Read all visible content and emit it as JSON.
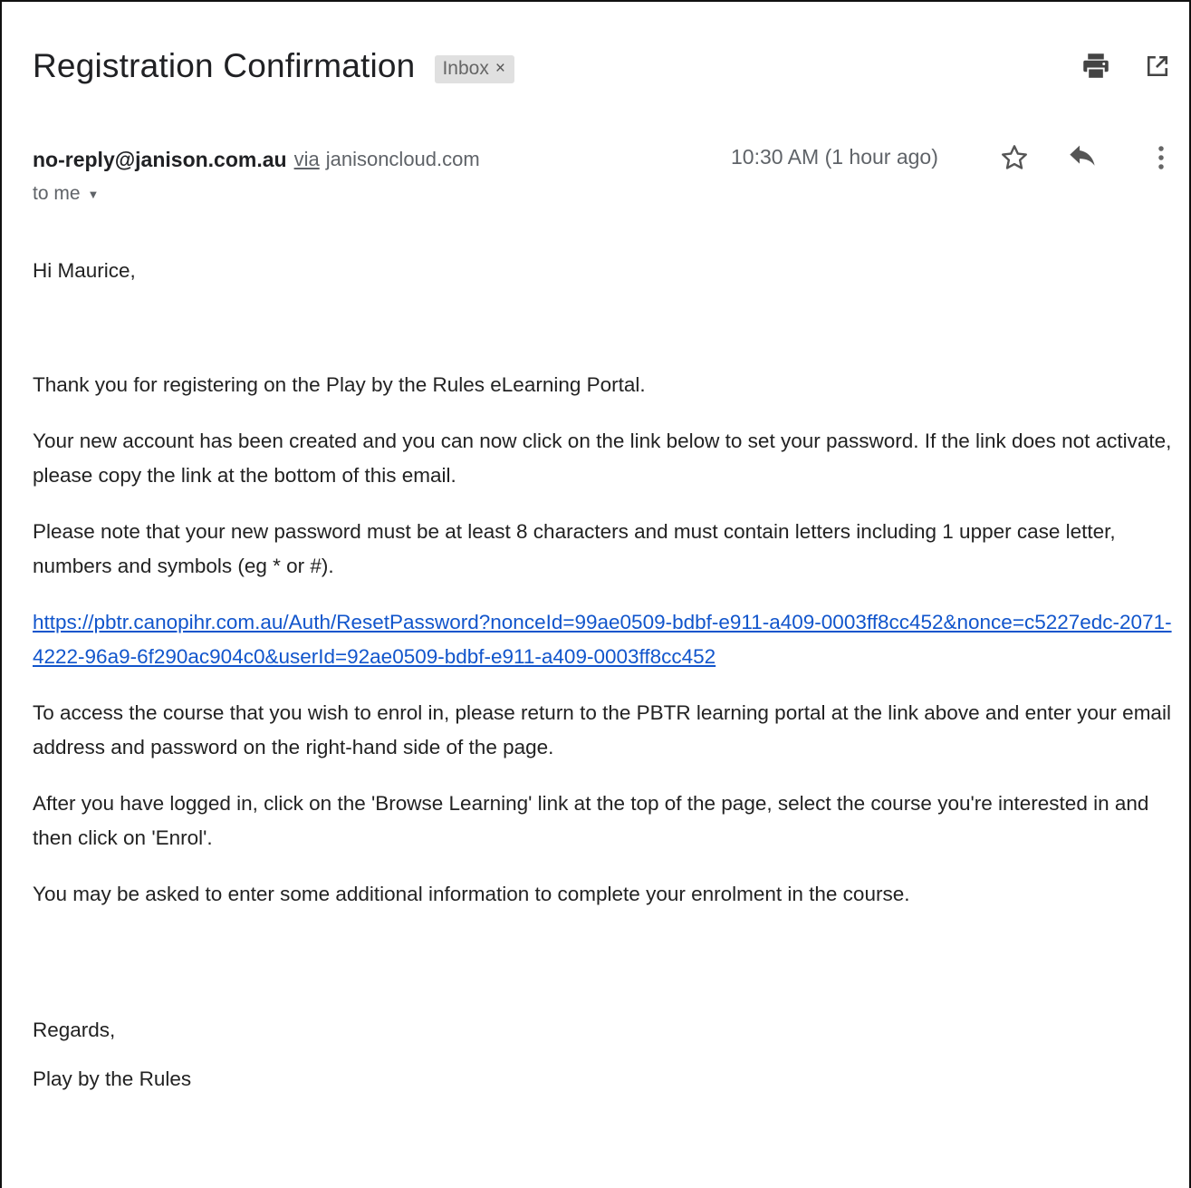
{
  "email": {
    "subject": "Registration Confirmation",
    "label": "Inbox",
    "label_close": "×",
    "sender": "no-reply@janison.com.au",
    "via_label": "via",
    "via_domain": "janisoncloud.com",
    "time": "10:30 AM (1 hour ago)",
    "recipient": "to me",
    "body": {
      "greeting": "Hi Maurice,",
      "paragraphs": [
        "Thank you for registering on the Play by the Rules eLearning Portal.",
        "Your new account has been created and you can now click on the link below to set your password. If the link does not activate, please copy the link at the bottom of this email.",
        "Please note that your new password must be at least 8 characters and must contain letters including 1 upper case letter, numbers and symbols (eg * or #)."
      ],
      "link": "https://pbtr.canopihr.com.au/Auth/ResetPassword?nonceId=99ae0509-bdbf-e911-a409-0003ff8cc452&nonce=c5227edc-2071-4222-96a9-6f290ac904c0&userId=92ae0509-bdbf-e911-a409-0003ff8cc452",
      "paragraphs_after": [
        "To access the course that you wish to enrol in, please return to the PBTR learning portal at the link above and enter your email address and password on the right-hand side of the page.",
        "After you have logged in, click on the 'Browse Learning' link at the top of the page, select the course you're interested in and then click on 'Enrol'.",
        "You may be asked to enter some additional information to complete your enrolment in the course."
      ],
      "closing": "Regards,",
      "signature": "Play by the Rules"
    }
  },
  "icons": {
    "print": "print-icon",
    "open_new_window": "open-in-new-window-icon",
    "star": "star-icon",
    "reply": "reply-icon",
    "more": "more-vertical-icon",
    "recipient_caret": "caret-down-icon"
  },
  "colors": {
    "link": "#1155cc",
    "chip_bg": "#e0e0e0",
    "muted_text": "#5f6368"
  }
}
